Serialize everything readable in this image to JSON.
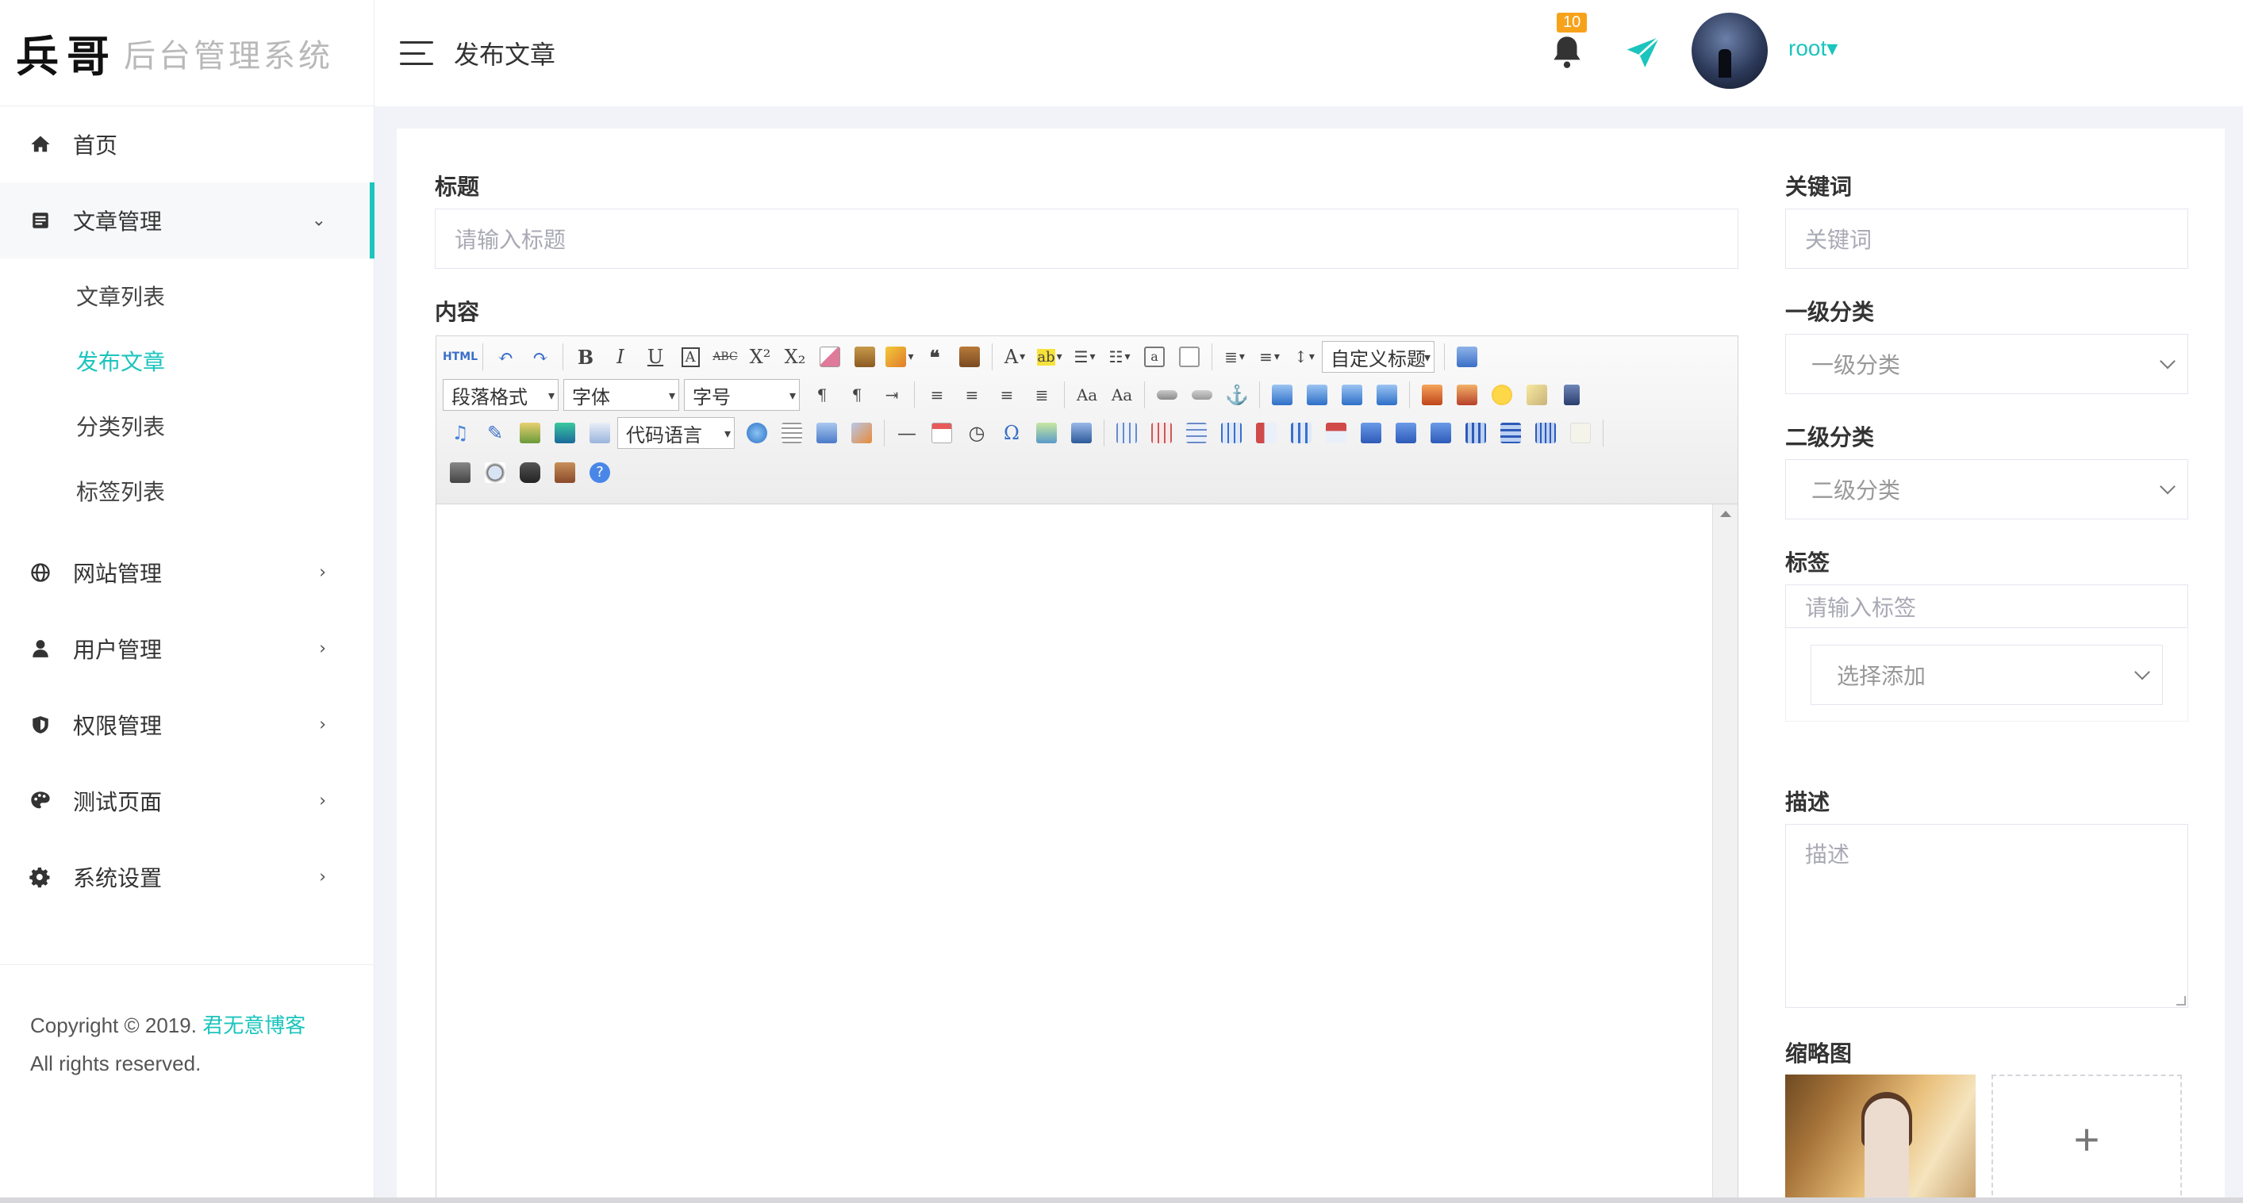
{
  "brand": {
    "mark": "兵哥",
    "text": "后台管理系统"
  },
  "sidebar": {
    "items": [
      {
        "label": "首页",
        "icon": "home-icon"
      },
      {
        "label": "文章管理",
        "icon": "article-icon",
        "open": true,
        "chevron": "⌄"
      },
      {
        "label": "网站管理",
        "icon": "globe-icon",
        "chevron": "›"
      },
      {
        "label": "用户管理",
        "icon": "user-icon",
        "chevron": "›"
      },
      {
        "label": "权限管理",
        "icon": "shield-icon",
        "chevron": "›"
      },
      {
        "label": "测试页面",
        "icon": "palette-icon",
        "chevron": "›"
      },
      {
        "label": "系统设置",
        "icon": "gear-icon",
        "chevron": "›"
      }
    ],
    "subitems": [
      {
        "label": "文章列表"
      },
      {
        "label": "发布文章",
        "active": true
      },
      {
        "label": "分类列表"
      },
      {
        "label": "标签列表"
      }
    ],
    "footer": {
      "copyright": "Copyright © 2019.",
      "link": "君无意博客",
      "rights": "All rights reserved."
    }
  },
  "header": {
    "page_title": "发布文章",
    "notification_count": "10",
    "user": "root▾"
  },
  "form": {
    "title_label": "标题",
    "title_placeholder": "请输入标题",
    "content_label": "内容",
    "keywords_label": "关键词",
    "keywords_placeholder": "关键词",
    "cat1_label": "一级分类",
    "cat1_value": "一级分类",
    "cat2_label": "二级分类",
    "cat2_value": "二级分类",
    "tags_label": "标签",
    "tags_placeholder": "请输入标签",
    "tags_select": "选择添加",
    "desc_label": "描述",
    "desc_placeholder": "描述",
    "thumb_label": "缩略图",
    "add_symbol": "+"
  },
  "editor": {
    "html_button": "HTML",
    "custom_title": "自定义标题",
    "paragraph_format": "段落格式",
    "font_family": "字体",
    "font_size": "字号",
    "code_language": "代码语言"
  },
  "colors": {
    "accent": "#1bc5bd",
    "badge": "#f7a21b"
  }
}
